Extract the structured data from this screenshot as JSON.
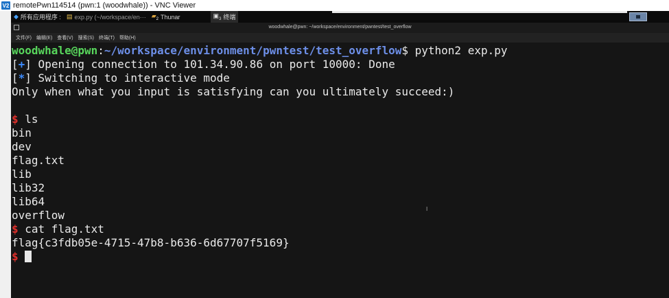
{
  "vnc": {
    "logo": "V2",
    "title": "remotePwn114514 (pwn:1 (woodwhale)) - VNC Viewer"
  },
  "taskbar": {
    "apps_menu": "所有应用程序 :",
    "tasks": [
      {
        "label": "exp.py (~/workspace/en···",
        "icon": "file-icon"
      },
      {
        "label": "Thunar",
        "icon": "folder-icon",
        "badge": "2"
      },
      {
        "label": "终端",
        "icon": "terminal-icon",
        "badge": "3"
      }
    ]
  },
  "window": {
    "title": "woodwhale@pwn: ~/workspace/environment/pwntest/test_overflow"
  },
  "menu": [
    "文件(F)",
    "编辑(E)",
    "查看(V)",
    "搜索(S)",
    "终端(T)",
    "帮助(H)"
  ],
  "terminal": {
    "prompt_user": "woodwhale@pwn",
    "prompt_sep": ":",
    "prompt_path": "~/workspace/environment/pwntest/test_overflow",
    "prompt_dollar": "$",
    "command1": " python2 exp.py",
    "info1_bracket_open": "[",
    "info1_mark": "+",
    "info1_bracket_close": "]",
    "info1_text": " Opening connection to 101.34.90.86 on port 10000: Done",
    "info2_bracket_open": "[",
    "info2_mark": "*",
    "info2_bracket_close": "]",
    "info2_text": " Switching to interactive mode",
    "banner": "Only when what you input is satisfying can you ultimately succeed:)",
    "shell_prompt": "$",
    "cmd_ls": " ls",
    "ls_output": [
      "bin",
      "dev",
      "flag.txt",
      "lib",
      "lib32",
      "lib64",
      "overflow"
    ],
    "cmd_cat": " cat flag.txt",
    "flag": "flag{c3fdb05e-4715-47b8-b636-6d67707f5169}"
  }
}
